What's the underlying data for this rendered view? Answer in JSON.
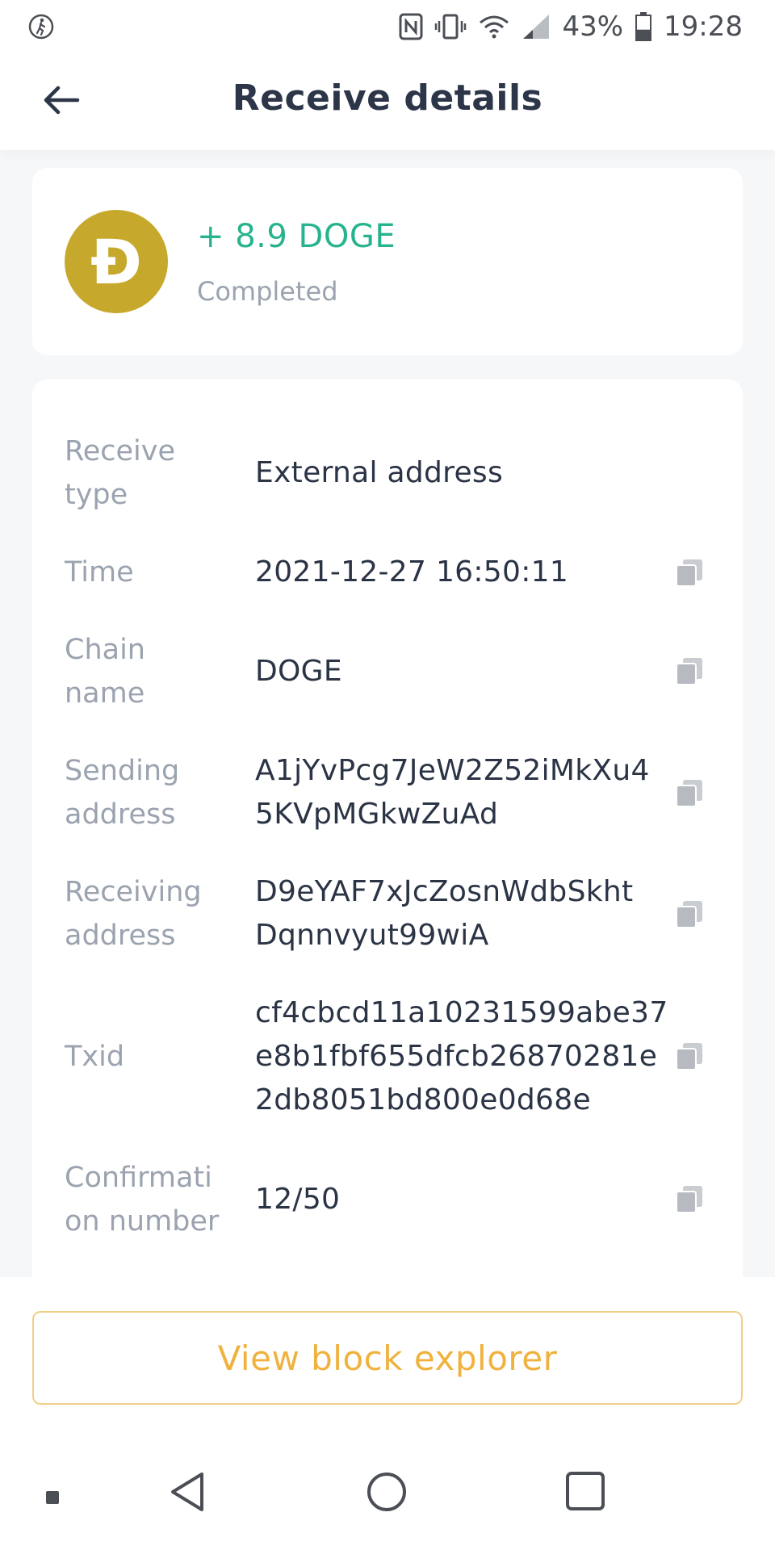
{
  "status_bar": {
    "battery_percent": "43%",
    "time": "19:28",
    "battery_level": 0.43
  },
  "header": {
    "title": "Receive details"
  },
  "summary": {
    "coin_symbol_glyph": "Ð",
    "amount": "+ 8.9 DOGE",
    "status": "Completed",
    "coin_color": "#c6a92c",
    "amount_color": "#27b38e"
  },
  "details": {
    "rows": [
      {
        "label_lines": [
          "Receive",
          "type"
        ],
        "value": "External address"
      },
      {
        "label_lines": [
          "Time"
        ],
        "value": "2021-12-27 16:50:11"
      },
      {
        "label_lines": [
          "Chain",
          "name"
        ],
        "value": "DOGE"
      },
      {
        "label_lines": [
          "Sending",
          "address"
        ],
        "value_lines": [
          "A1jYvPcg7JeW2Z52iMkXu4",
          "5KVpMGkwZuAd"
        ]
      },
      {
        "label_lines": [
          "Receiving",
          "address"
        ],
        "value_lines": [
          "D9eYAF7xJcZosnWdbSkht",
          "Dqnnvyut99wiA"
        ]
      },
      {
        "label_lines": [
          "Txid"
        ],
        "value_lines": [
          "cf4cbcd11a10231599abe37",
          "e8b1fbf655dfcb26870281e",
          "2db8051bd800e0d68e"
        ]
      },
      {
        "label_lines": [
          "Confirmati",
          "on number"
        ],
        "value": "12/50"
      }
    ]
  },
  "actions": {
    "view_explorer_label": "View block explorer",
    "accent_color": "#f0b23e"
  },
  "icons": {
    "back": "arrow-left-icon",
    "copy": "copy-icon"
  }
}
